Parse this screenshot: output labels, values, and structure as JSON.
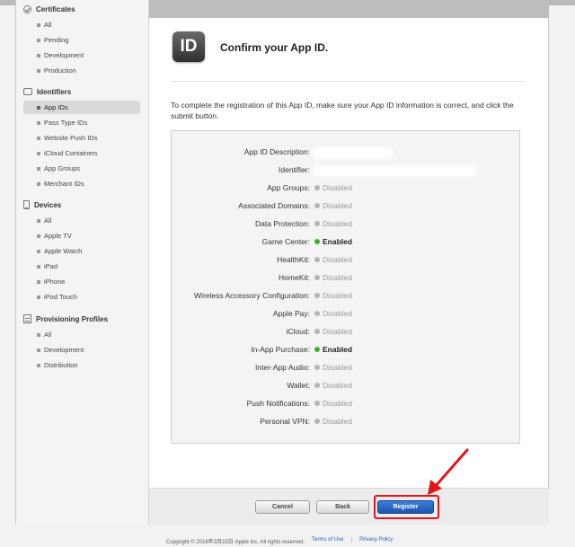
{
  "sidebar": {
    "sections": [
      {
        "title": "Certificates",
        "icon": "certificate-icon",
        "items": [
          "All",
          "Pending",
          "Development",
          "Production"
        ]
      },
      {
        "title": "Identifiers",
        "icon": "id-icon",
        "items": [
          "App IDs",
          "Pass Type IDs",
          "Website Push IDs",
          "iCloud Containers",
          "App Groups",
          "Merchant IDs"
        ]
      },
      {
        "title": "Devices",
        "icon": "device-icon",
        "items": [
          "All",
          "Apple TV",
          "Apple Watch",
          "iPad",
          "iPhone",
          "iPod Touch"
        ]
      },
      {
        "title": "Provisioning Profiles",
        "icon": "profile-icon",
        "items": [
          "All",
          "Development",
          "Distribution"
        ]
      }
    ],
    "active_item": "App IDs"
  },
  "header": {
    "icon_text": "ID",
    "title": "Confirm your App ID."
  },
  "intro": "To complete the registration of this App ID, make sure your App ID information is correct, and click the submit button.",
  "details": [
    {
      "label": "App ID Description:",
      "value": "",
      "status": "redacted"
    },
    {
      "label": "Identifier:",
      "value": "",
      "status": "redacted"
    },
    {
      "label": "App Groups:",
      "value": "Disabled",
      "status": "disabled"
    },
    {
      "label": "Associated Domains:",
      "value": "Disabled",
      "status": "disabled"
    },
    {
      "label": "Data Protection:",
      "value": "Disabled",
      "status": "disabled"
    },
    {
      "label": "Game Center:",
      "value": "Enabled",
      "status": "enabled"
    },
    {
      "label": "HealthKit:",
      "value": "Disabled",
      "status": "disabled"
    },
    {
      "label": "HomeKit:",
      "value": "Disabled",
      "status": "disabled"
    },
    {
      "label": "Wireless Accessory Configuration:",
      "value": "Disabled",
      "status": "disabled"
    },
    {
      "label": "Apple Pay:",
      "value": "Disabled",
      "status": "disabled"
    },
    {
      "label": "iCloud:",
      "value": "Disabled",
      "status": "disabled"
    },
    {
      "label": "In-App Purchase:",
      "value": "Enabled",
      "status": "enabled"
    },
    {
      "label": "Inter-App Audio:",
      "value": "Disabled",
      "status": "disabled"
    },
    {
      "label": "Wallet:",
      "value": "Disabled",
      "status": "disabled"
    },
    {
      "label": "Push Notifications:",
      "value": "Disabled",
      "status": "disabled"
    },
    {
      "label": "Personal VPN:",
      "value": "Disabled",
      "status": "disabled"
    }
  ],
  "buttons": {
    "cancel": "Cancel",
    "back": "Back",
    "register": "Register"
  },
  "footer": {
    "copyright": "Copyright © 2016年3月15日 Apple Inc. All rights reserved.",
    "terms": "Terms of Use",
    "privacy": "Privacy Policy"
  },
  "colors": {
    "enabled": "#3cb22c",
    "disabled": "#b5b5b5",
    "primary_button": "#1c55b3",
    "highlight": "#e3151c"
  }
}
